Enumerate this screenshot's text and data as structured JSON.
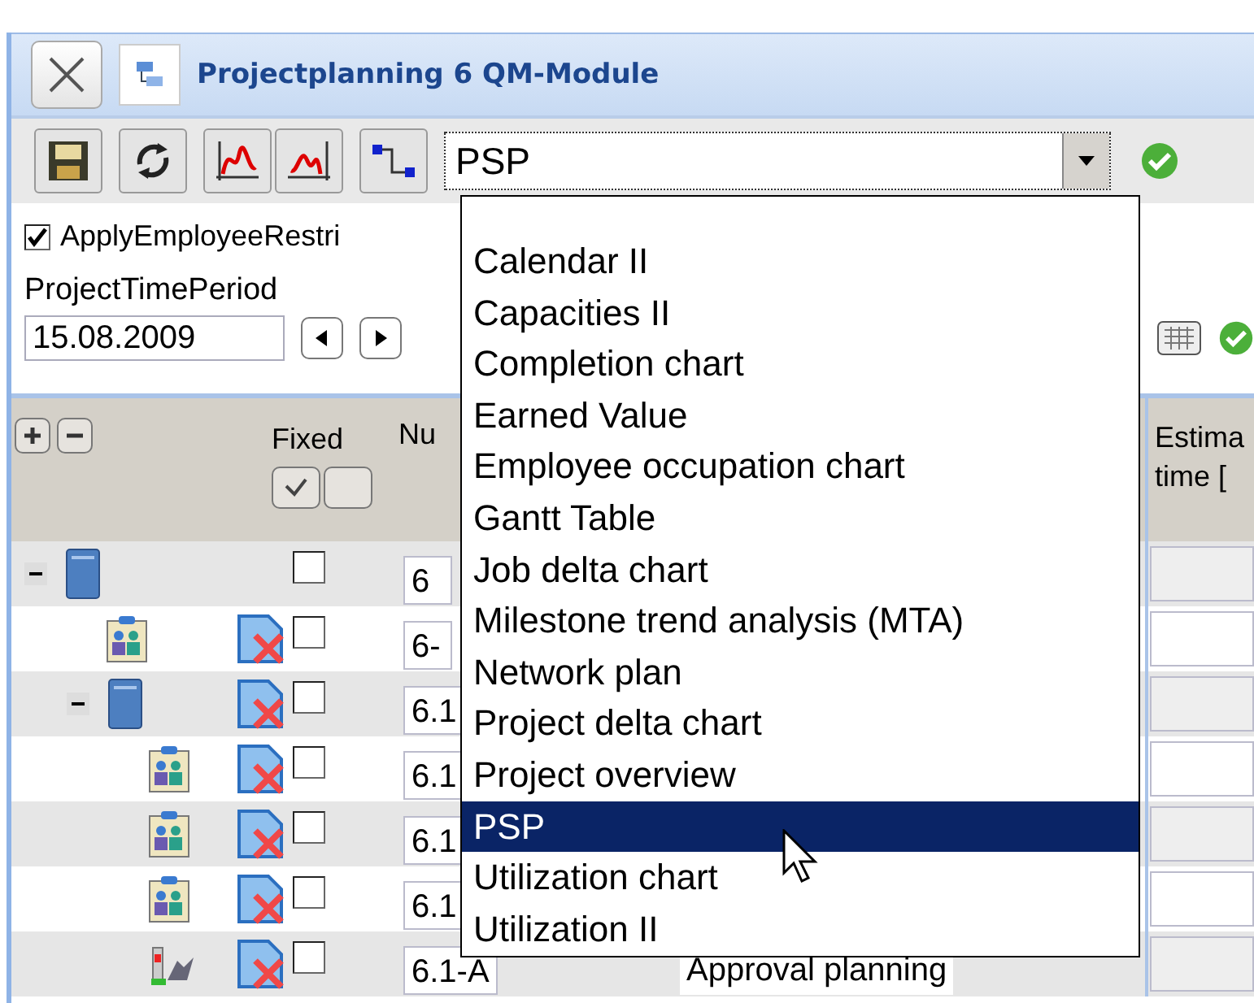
{
  "window": {
    "title": "Projectplanning 6 QM-Module"
  },
  "toolbar": {
    "view_select": {
      "value": "PSP"
    }
  },
  "dropdown": {
    "items": [
      {
        "label": "Calendar II",
        "selected": false
      },
      {
        "label": "Capacities II",
        "selected": false
      },
      {
        "label": "Completion chart",
        "selected": false
      },
      {
        "label": "Earned Value",
        "selected": false
      },
      {
        "label": "Employee occupation chart",
        "selected": false
      },
      {
        "label": "Gantt Table",
        "selected": false
      },
      {
        "label": "Job delta chart",
        "selected": false
      },
      {
        "label": "Milestone trend analysis (MTA)",
        "selected": false
      },
      {
        "label": "Network plan",
        "selected": false
      },
      {
        "label": "Project delta chart",
        "selected": false
      },
      {
        "label": "Project overview",
        "selected": false
      },
      {
        "label": "PSP",
        "selected": true
      },
      {
        "label": "Utilization chart",
        "selected": false
      },
      {
        "label": "Utilization II",
        "selected": false
      }
    ]
  },
  "form": {
    "restriction": {
      "label": "ApplyEmployeeRestri",
      "checked": true
    },
    "period_label": "ProjectTimePeriod",
    "date": "15.08.2009"
  },
  "table": {
    "columns": {
      "fixed": "Fixed",
      "number": "Nu",
      "estimate": [
        "Estima",
        "time ["
      ]
    },
    "rows": [
      {
        "kind": "folder",
        "number": "6",
        "fixed": false,
        "expanded": true,
        "children": [
          {
            "kind": "job",
            "number": "6-",
            "fixed": false
          },
          {
            "kind": "folder",
            "number": "6.1",
            "fixed": false,
            "expanded": true,
            "children": [
              {
                "kind": "job",
                "number": "6.1",
                "fixed": false
              },
              {
                "kind": "job",
                "number": "6.1",
                "fixed": false
              },
              {
                "kind": "job",
                "number": "6.1",
                "fixed": false
              },
              {
                "kind": "milestone",
                "number": "6.1-A",
                "name": "Approval planning",
                "fixed": false
              }
            ]
          }
        ]
      }
    ]
  }
}
